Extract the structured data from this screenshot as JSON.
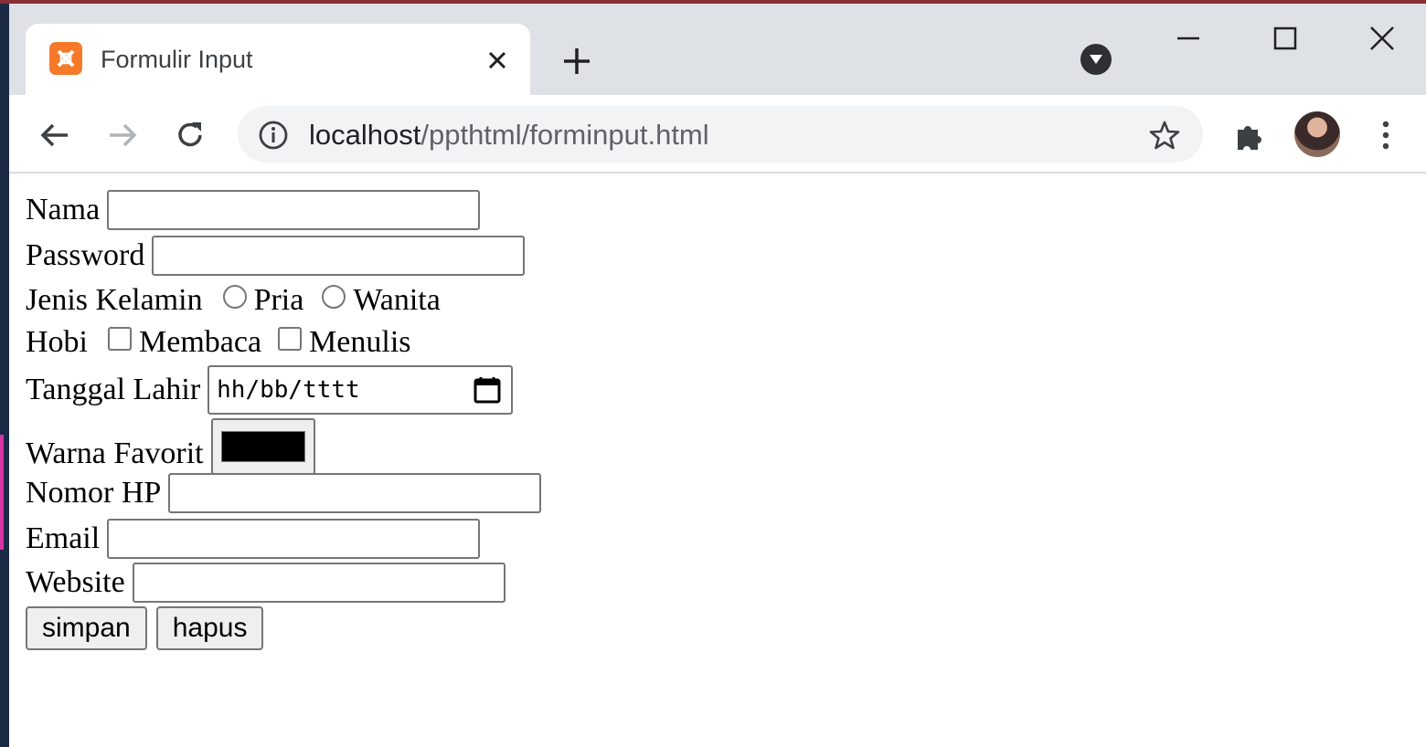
{
  "browser": {
    "tab": {
      "title": "Formulir Input",
      "favicon": "xampp-icon"
    },
    "address_bar": {
      "url_host": "localhost",
      "url_path": "/ppthtml/forminput.html"
    },
    "icons": [
      "back-icon",
      "forward-icon",
      "reload-icon",
      "info-icon",
      "star-icon",
      "extensions-icon",
      "profile-avatar",
      "menu-icon",
      "minimize-icon",
      "maximize-icon",
      "close-icon",
      "new-tab-icon",
      "tab-search-icon"
    ]
  },
  "form": {
    "nama_label": "Nama",
    "password_label": "Password",
    "gender_label": "Jenis Kelamin",
    "gender_options": [
      "Pria",
      "Wanita"
    ],
    "hobby_label": "Hobi",
    "hobby_options": [
      "Membaca",
      "Menulis"
    ],
    "birthdate_label": "Tanggal Lahir",
    "birthdate_placeholder": "hh/bb/tttt",
    "color_label": "Warna Favorit",
    "color_value": "#000000",
    "phone_label": "Nomor HP",
    "email_label": "Email",
    "website_label": "Website",
    "submit_label": "simpan",
    "reset_label": "hapus"
  }
}
